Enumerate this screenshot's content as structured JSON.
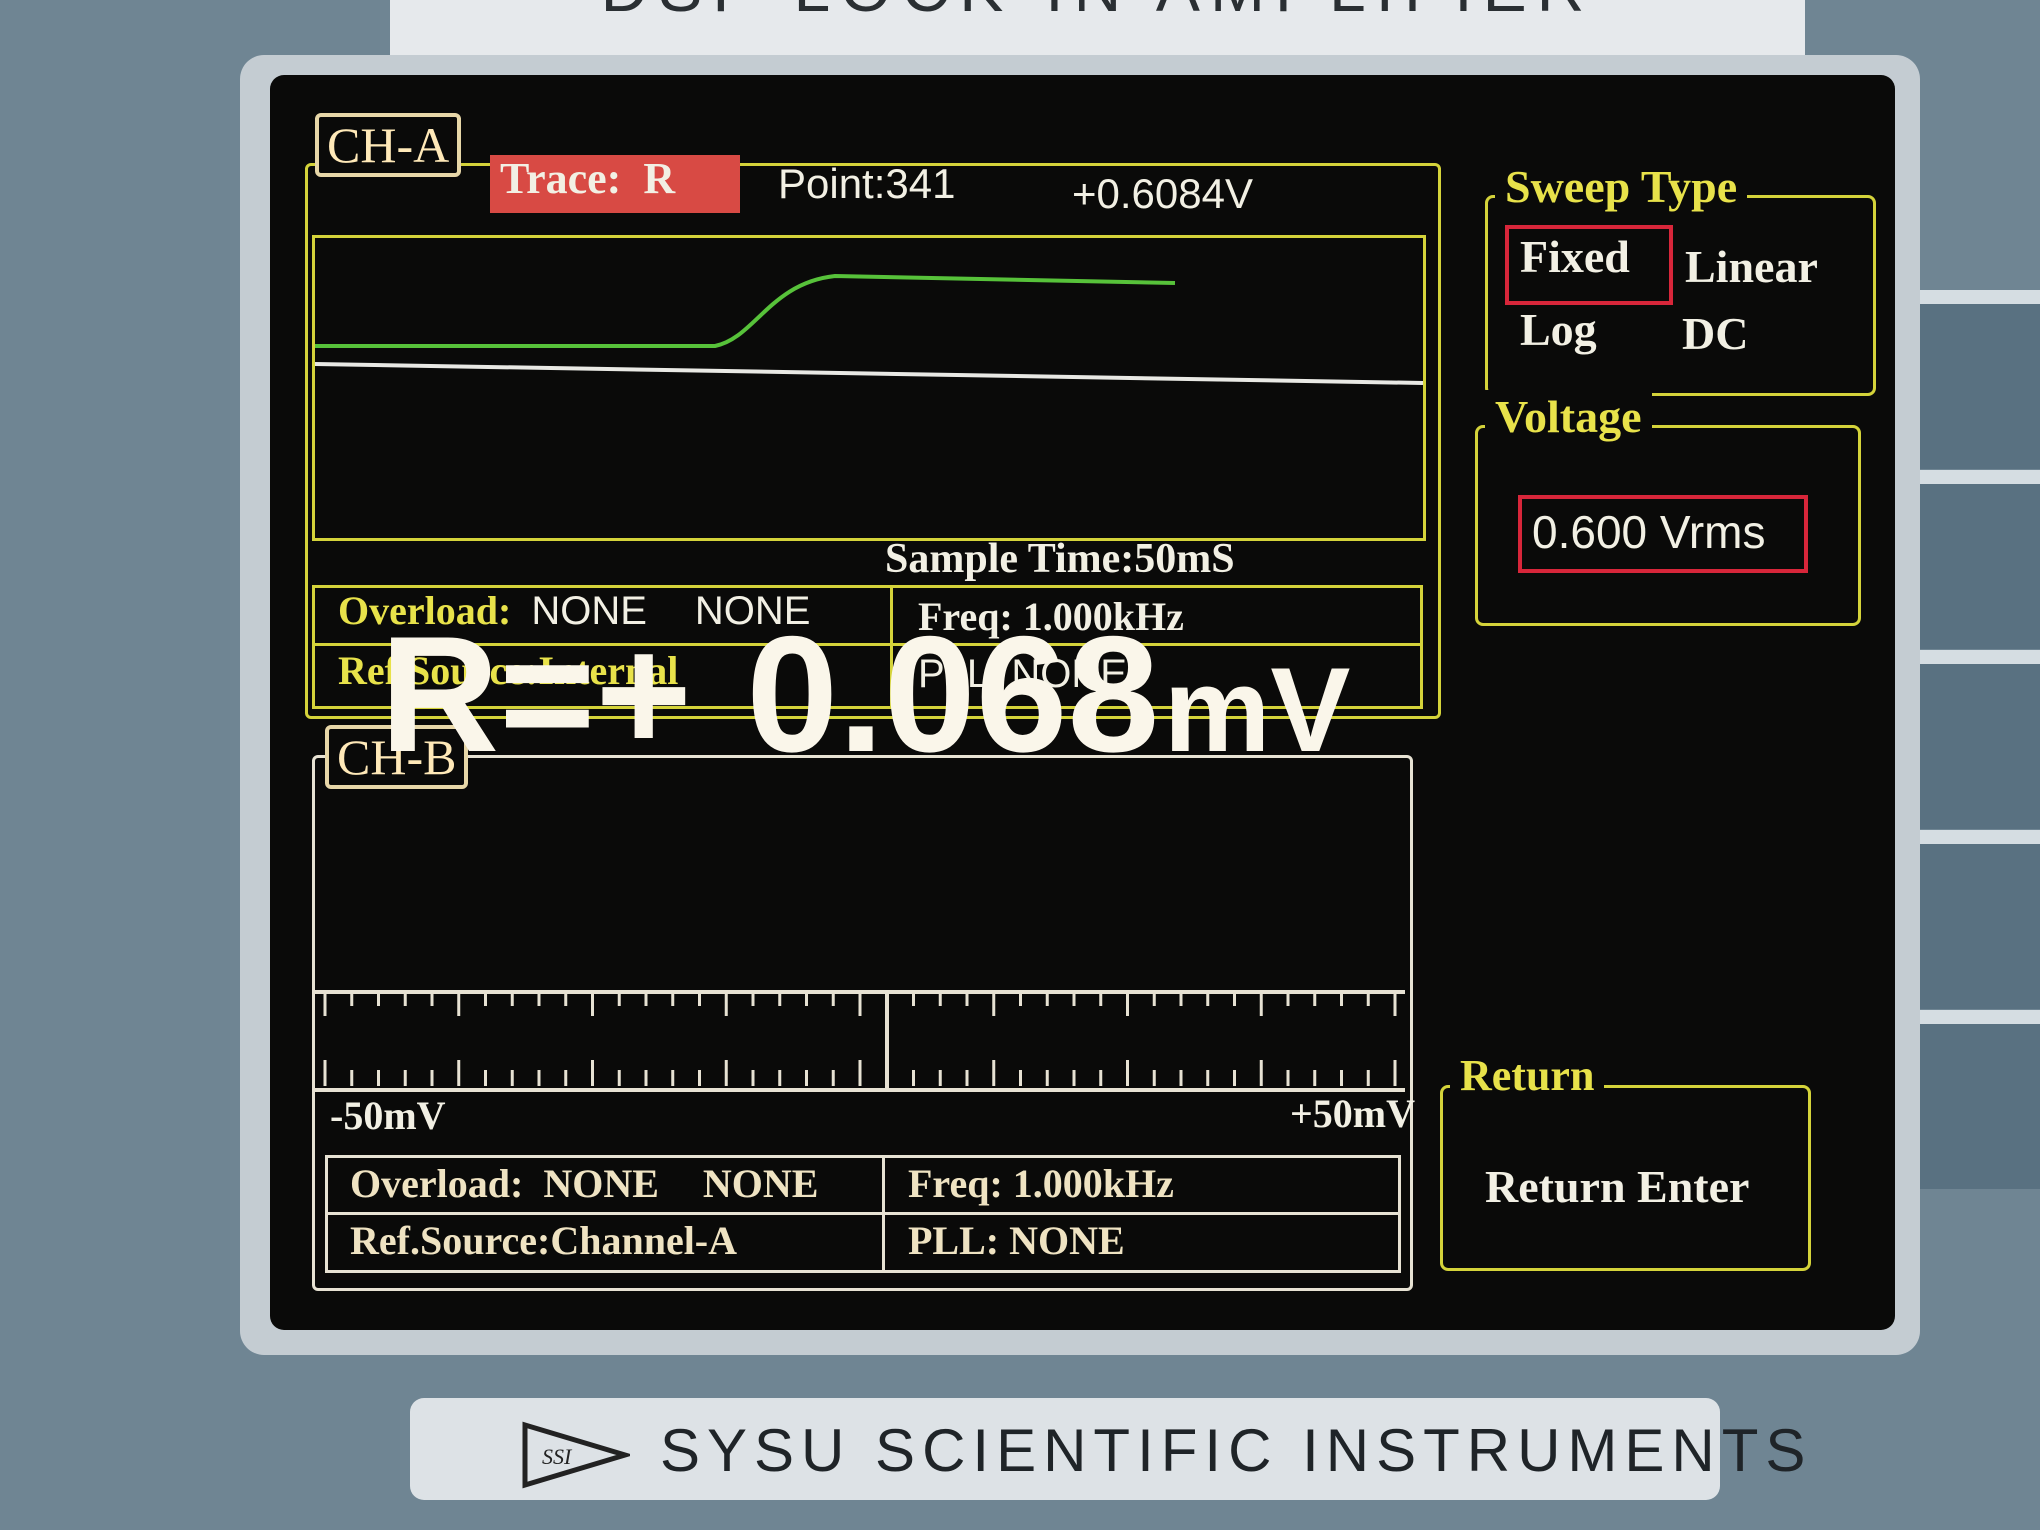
{
  "device": {
    "top_label": "DSP LOCK-IN AMPLIFIER",
    "brand": "SYSU SCIENTIFIC INSTRUMENTS",
    "logo_text": "SSI"
  },
  "ch_a": {
    "tag": "CH-A",
    "trace_label": "Trace:",
    "trace_value": "R",
    "point": "Point:341",
    "reading": "+0.6084V",
    "sample_time": "Sample  Time:50mS",
    "overload_label": "Overload:",
    "overload_1": "NONE",
    "overload_2": "NONE",
    "ref_source": "Ref.Source:Internal",
    "freq": "Freq: 1.000kHz",
    "pll": "PLL:  NONE"
  },
  "sweep_type": {
    "title": "Sweep Type",
    "options": [
      "Fixed",
      "Linear",
      "Log",
      "DC"
    ],
    "selected": "Fixed"
  },
  "voltage": {
    "title": "Voltage",
    "value": "0.600 Vrms"
  },
  "ch_b": {
    "tag": "CH-B",
    "readout_prefix": "R=+",
    "readout_value": "0.068",
    "readout_unit": "mV",
    "scale_min": "-50mV",
    "scale_max": "+50mV",
    "overload_label": "Overload:",
    "overload_1": "NONE",
    "overload_2": "NONE",
    "ref_source": "Ref.Source:Channel-A",
    "freq": "Freq: 1.000kHz",
    "pll": "PLL:  NONE"
  },
  "return_panel": {
    "title": "Return",
    "action": "Return Enter"
  },
  "colors": {
    "frame_yellow": "#d4d33a",
    "selection_red": "#d8263a",
    "trace_green": "#57c23a",
    "screen_bg": "#0a0a09"
  }
}
